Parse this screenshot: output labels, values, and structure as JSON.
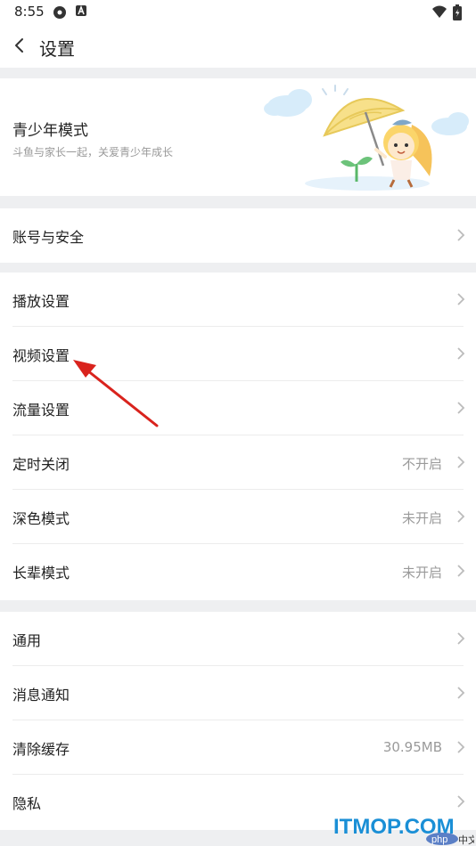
{
  "status_bar": {
    "time": "8:55"
  },
  "header": {
    "title": "设置"
  },
  "youth": {
    "title": "青少年模式",
    "subtitle": "斗鱼与家长一起，关爱青少年成长"
  },
  "account": {
    "label": "账号与安全"
  },
  "group2": [
    {
      "label": "播放设置",
      "value": ""
    },
    {
      "label": "视频设置",
      "value": ""
    },
    {
      "label": "流量设置",
      "value": ""
    },
    {
      "label": "定时关闭",
      "value": "不开启"
    },
    {
      "label": "深色模式",
      "value": "未开启"
    },
    {
      "label": "长辈模式",
      "value": "未开启"
    }
  ],
  "group3": [
    {
      "label": "通用",
      "value": ""
    },
    {
      "label": "消息通知",
      "value": ""
    },
    {
      "label": "清除缓存",
      "value": "30.95MB"
    },
    {
      "label": "隐私",
      "value": ""
    }
  ],
  "watermark": {
    "main": "ITMOP.COM",
    "sub_php": "php",
    "sub_cn": "中文网"
  },
  "colors": {
    "annotation_arrow": "#d9231d",
    "watermark": "#1a8fd6",
    "background": "#eeeff1"
  }
}
